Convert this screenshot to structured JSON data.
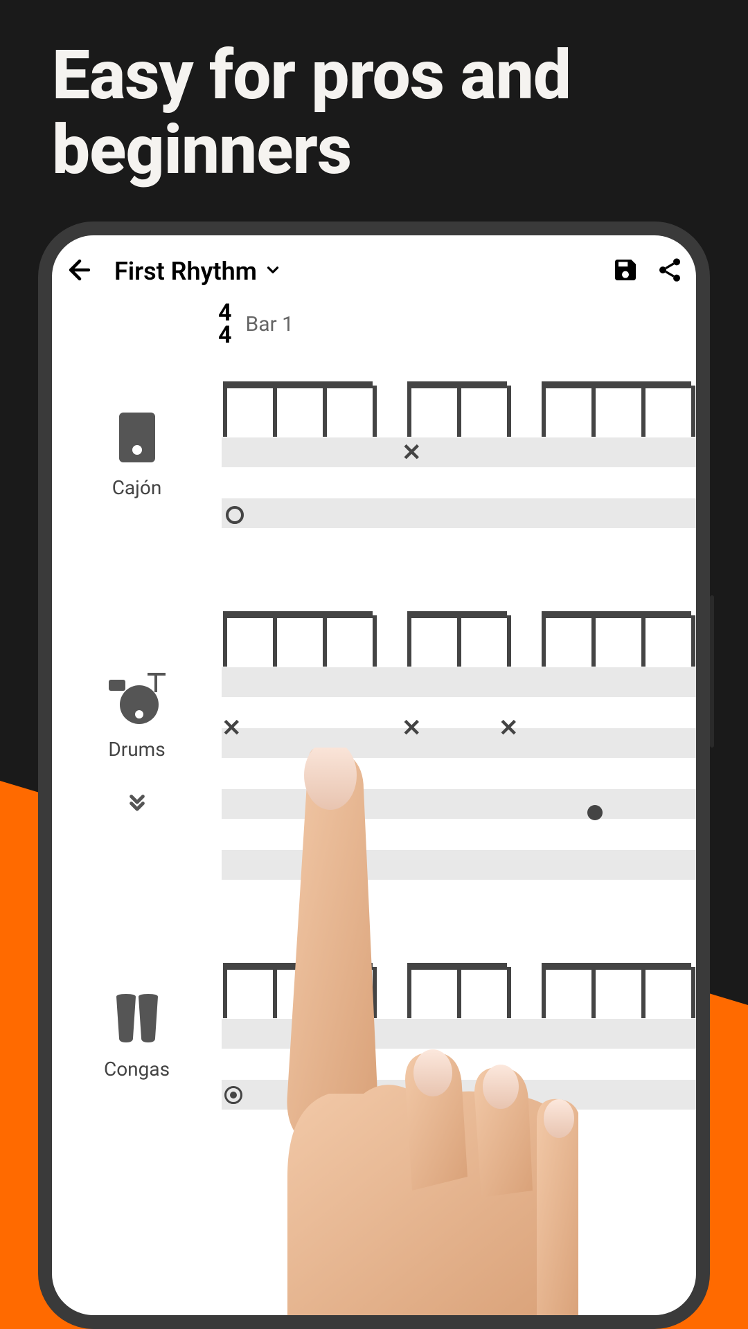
{
  "promo": {
    "headline": "Easy for pros and beginners"
  },
  "topbar": {
    "title": "First Rhythm"
  },
  "timesig": {
    "top": "4",
    "bottom": "4",
    "bar_label": "Bar 1"
  },
  "tracks": [
    {
      "label": "Cajón"
    },
    {
      "label": "Drums"
    },
    {
      "label": "Congas"
    }
  ]
}
